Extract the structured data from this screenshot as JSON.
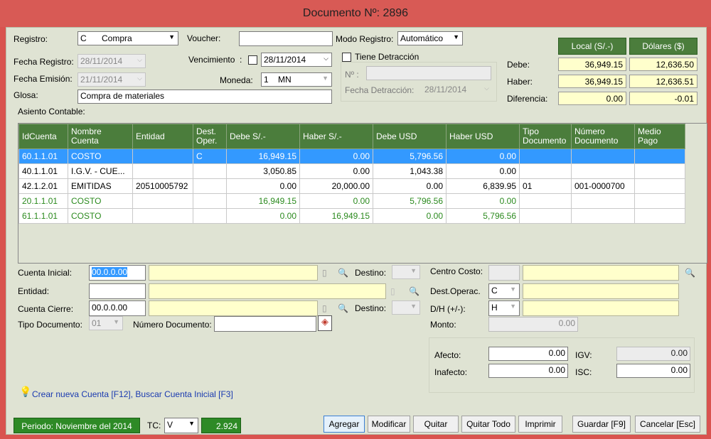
{
  "window": {
    "title": "Documento Nº: 2896"
  },
  "form": {
    "registro_label": "Registro:",
    "registro_code": "C",
    "registro_value": "Compra",
    "voucher_label": "Voucher:",
    "voucher_value": "",
    "modo_label": "Modo Registro:",
    "modo_value": "Automático",
    "fecha_registro_label": "Fecha Registro:",
    "fecha_registro_value": "28/11/2014",
    "vencimiento_label": "Vencimiento",
    "vencimiento_colon": ":",
    "vencimiento_value": "28/11/2014",
    "tiene_detraccion_label": "Tiene Detracción",
    "fecha_emision_label": "Fecha Emisión:",
    "fecha_emision_value": "21/11/2014",
    "moneda_label": "Moneda:",
    "moneda_code": "1",
    "moneda_value": "MN",
    "nro_label": "Nº :",
    "nro_value": "",
    "fecha_detraccion_label": "Fecha Detracción:",
    "fecha_detraccion_value": "28/11/2014",
    "glosa_label": "Glosa:",
    "glosa_value": "Compra de materiales",
    "asiento_label": "Asiento Contable:"
  },
  "summary": {
    "local_header": "Local (S/.-)",
    "dolares_header": "Dólares ($)",
    "debe_label": "Debe:",
    "haber_label": "Haber:",
    "diferencia_label": "Diferencia:",
    "debe_local": "36,949.15",
    "debe_usd": "12,636.50",
    "haber_local": "36,949.15",
    "haber_usd": "12,636.51",
    "dif_local": "0.00",
    "dif_usd": "-0.01"
  },
  "grid": {
    "columns": [
      "IdCuenta",
      "Nombre Cuenta",
      "Entidad",
      "Dest. Oper.",
      "Debe S/.-",
      "Haber S/.-",
      "Debe USD",
      "Haber USD",
      "Tipo Documento",
      "Número Documento",
      "Medio Pago"
    ],
    "rows": [
      {
        "id": "60.1.1.01",
        "nombre": "COSTO",
        "entidad": "",
        "dest": "C",
        "debe_s": "16,949.15",
        "haber_s": "0.00",
        "debe_usd": "5,796.56",
        "haber_usd": "0.00",
        "tipo": "",
        "numero": "",
        "medio": ""
      },
      {
        "id": "40.1.1.01",
        "nombre": "I.G.V. - CUE...",
        "entidad": "",
        "dest": "",
        "debe_s": "3,050.85",
        "haber_s": "0.00",
        "debe_usd": "1,043.38",
        "haber_usd": "0.00",
        "tipo": "",
        "numero": "",
        "medio": ""
      },
      {
        "id": "42.1.2.01",
        "nombre": "EMITIDAS",
        "entidad": "20510005792",
        "dest": "",
        "debe_s": "0.00",
        "haber_s": "20,000.00",
        "debe_usd": "0.00",
        "haber_usd": "6,839.95",
        "tipo": "01",
        "numero": "001-0000700",
        "medio": ""
      },
      {
        "id": "20.1.1.01",
        "nombre": "COSTO",
        "entidad": "",
        "dest": "",
        "debe_s": "16,949.15",
        "haber_s": "0.00",
        "debe_usd": "5,796.56",
        "haber_usd": "0.00",
        "tipo": "",
        "numero": "",
        "medio": ""
      },
      {
        "id": "61.1.1.01",
        "nombre": "COSTO",
        "entidad": "",
        "dest": "",
        "debe_s": "0.00",
        "haber_s": "16,949.15",
        "debe_usd": "0.00",
        "haber_usd": "5,796.56",
        "tipo": "",
        "numero": "",
        "medio": ""
      }
    ]
  },
  "editor": {
    "cuenta_inicial_label": "Cuenta Inicial:",
    "cuenta_inicial_value": "00.0.0.00",
    "destino_label": "Destino:",
    "centro_costo_label": "Centro Costo:",
    "entidad_label": "Entidad:",
    "dest_operac_label": "Dest.Operac.",
    "dest_operac_value": "C",
    "cuenta_cierre_label": "Cuenta Cierre:",
    "cuenta_cierre_value": "00.0.0.00",
    "destino2_label": "Destino:",
    "dh_label": "D/H (+/-):",
    "dh_value": "H",
    "tipo_doc_label": "Tipo Documento:",
    "tipo_doc_value": "01",
    "numero_doc_label": "Número Documento:",
    "monto_label": "Monto:",
    "monto_value": "0.00",
    "afecto_label": "Afecto:",
    "afecto_value": "0.00",
    "inafecto_label": "Inafecto:",
    "inafecto_value": "0.00",
    "igv_label": "IGV:",
    "igv_value": "0.00",
    "isc_label": "ISC:",
    "isc_value": "0.00"
  },
  "hint": "Crear nueva Cuenta [F12], Buscar Cuenta Inicial [F3]",
  "footer": {
    "periodo": "Periodo: Noviembre del 2014",
    "tc_label": "TC:",
    "tc_type": "V",
    "tc_value": "2.924",
    "btn_agregar": "Agregar",
    "btn_modificar": "Modificar",
    "btn_quitar": "Quitar",
    "btn_quitar_todo": "Quitar Todo",
    "btn_imprimir": "Imprimir",
    "btn_guardar": "Guardar [F9]",
    "btn_cancelar": "Cancelar [Esc]"
  },
  "colors": {
    "accent_green": "#4b7d3c",
    "selection_blue": "#3399ff",
    "title_red": "#d85a55",
    "form_bg": "#dfe3d3"
  }
}
